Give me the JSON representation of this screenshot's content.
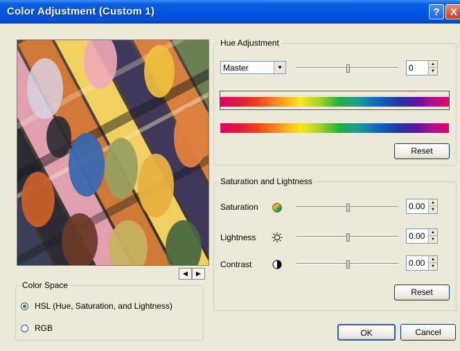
{
  "window": {
    "title": "Color Adjustment (Custom 1)",
    "help_glyph": "?",
    "close_glyph": "X"
  },
  "hue_adjustment": {
    "legend": "Hue Adjustment",
    "channel": "Master",
    "value": "0",
    "slider_level": 0.5,
    "reset_label": "Reset"
  },
  "saturation_lightness": {
    "legend": "Saturation and Lightness",
    "rows": [
      {
        "label": "Saturation",
        "value": "0.00",
        "icon": "color-wheel-icon",
        "slider_level": 0.5
      },
      {
        "label": "Lightness",
        "value": "0.00",
        "icon": "sun-icon",
        "slider_level": 0.5
      },
      {
        "label": "Contrast",
        "value": "0.00",
        "icon": "contrast-icon",
        "slider_level": 0.5
      }
    ],
    "reset_label": "Reset"
  },
  "color_space": {
    "legend": "Color Space",
    "options": [
      {
        "label": "HSL (Hue, Saturation, and Lightness)",
        "selected": true
      },
      {
        "label": "RGB",
        "selected": false
      }
    ]
  },
  "buttons": {
    "ok": "OK",
    "cancel": "Cancel"
  },
  "colors": {
    "titlebar": "#0054e3",
    "dialog_bg": "#ece9d8",
    "button_border": "#003c74"
  }
}
